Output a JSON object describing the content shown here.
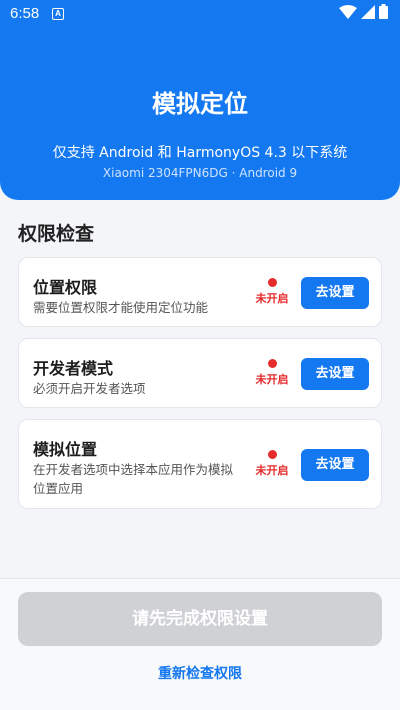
{
  "status_bar": {
    "time": "6:58",
    "notification_icon": "A",
    "icons": [
      "wifi-icon",
      "signal-icon",
      "battery-icon"
    ]
  },
  "header": {
    "title": "模拟定位",
    "subtitle": "仅支持 Android 和 HarmonyOS 4.3 以下系统",
    "device_info": "Xiaomi 2304FPN6DG · Android 9"
  },
  "permissions": {
    "section_title": "权限检查",
    "items": [
      {
        "title": "位置权限",
        "description": "需要位置权限才能使用定位功能",
        "status": "未开启",
        "action": "去设置"
      },
      {
        "title": "开发者模式",
        "description": "必须开启开发者选项",
        "status": "未开启",
        "action": "去设置"
      },
      {
        "title": "模拟位置",
        "description": "在开发者选项中选择本应用作为模拟位置应用",
        "status": "未开启",
        "action": "去设置"
      }
    ]
  },
  "footer": {
    "main_button": "请先完成权限设置",
    "recheck_button": "重新检查权限"
  },
  "colors": {
    "primary": "#1478f0",
    "status_off": "#e52b2b",
    "disabled": "#cfd1d4",
    "background": "#f3f5f8"
  }
}
